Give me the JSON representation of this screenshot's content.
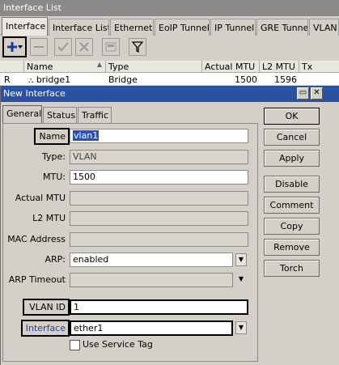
{
  "list_window": {
    "title": "Interface List",
    "tabs": [
      "Interface",
      "Interface List",
      "Ethernet",
      "EoIP Tunnel",
      "IP Tunnel",
      "GRE Tunnel",
      "VLAN"
    ],
    "toolbar": {
      "add_icon": "plus-icon",
      "remove_icon": "minus-icon",
      "enable_icon": "check-icon",
      "disable_icon": "x-icon",
      "comment_icon": "comment-icon",
      "filter_icon": "filter-icon"
    },
    "columns": [
      "",
      "Name",
      "Type",
      "Actual MTU",
      "L2 MTU",
      "Tx"
    ],
    "rows": [
      {
        "flag": "R",
        "name": "bridge1",
        "type": "Bridge",
        "actual_mtu": "1500",
        "l2_mtu": "1596",
        "tx": ""
      }
    ]
  },
  "dialog": {
    "title": "New Interface",
    "tabs": [
      "General",
      "Status",
      "Traffic"
    ],
    "fields": {
      "name": {
        "label": "Name",
        "value": "vlan1"
      },
      "type": {
        "label": "Type:",
        "value": "VLAN"
      },
      "mtu": {
        "label": "MTU:",
        "value": "1500"
      },
      "actual_mtu": {
        "label": "Actual MTU",
        "value": ""
      },
      "l2_mtu": {
        "label": "L2 MTU",
        "value": ""
      },
      "mac_address": {
        "label": "MAC Address",
        "value": ""
      },
      "arp": {
        "label": "ARP:",
        "value": "enabled"
      },
      "arp_timeout": {
        "label": "ARP Timeout",
        "value": ""
      },
      "vlan_id": {
        "label": "VLAN ID",
        "value": "1"
      },
      "interface": {
        "label": "Interface",
        "value": "ether1"
      }
    },
    "use_service_tag_label": "Use Service Tag",
    "use_service_tag_checked": false,
    "buttons": [
      "OK",
      "Cancel",
      "Apply",
      "Disable",
      "Comment",
      "Copy",
      "Remove",
      "Torch"
    ]
  }
}
